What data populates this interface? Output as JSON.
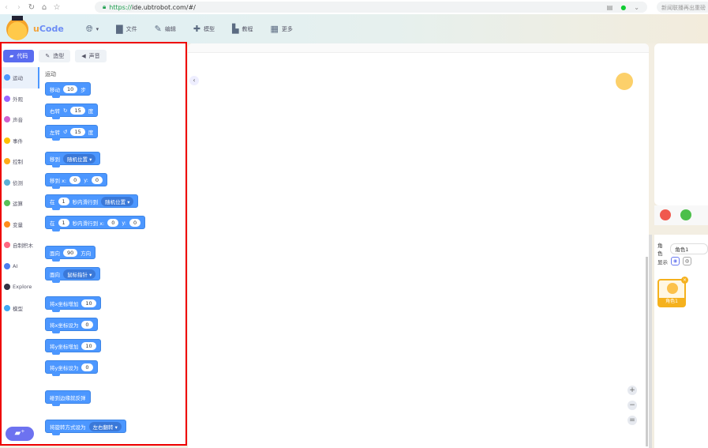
{
  "browser": {
    "url_scheme": "https://",
    "url_rest": "ide.ubtrobot.com/#/",
    "search_text": "新闻联播再出重磅"
  },
  "header": {
    "brand_u": "u",
    "brand_code": "Code",
    "menu": [
      {
        "icon": "folder-icon",
        "glyph": "▇",
        "label": "文件"
      },
      {
        "icon": "pencil-icon",
        "glyph": "✎",
        "label": "编辑"
      },
      {
        "icon": "puzzle-icon",
        "glyph": "✚",
        "label": "模型"
      },
      {
        "icon": "tutorial-icon",
        "glyph": "▙",
        "label": "教程"
      },
      {
        "icon": "grid-icon",
        "glyph": "▦",
        "label": "更多"
      }
    ]
  },
  "tabs": [
    {
      "label": "代码",
      "glyph": "▰"
    },
    {
      "label": "造型",
      "glyph": "✎"
    },
    {
      "label": "声音",
      "glyph": "◀"
    }
  ],
  "categories": [
    {
      "label": "运动",
      "color": "#4c97ff"
    },
    {
      "label": "外观",
      "color": "#9966ff"
    },
    {
      "label": "声音",
      "color": "#cf63cf"
    },
    {
      "label": "事件",
      "color": "#ffbf00"
    },
    {
      "label": "控制",
      "color": "#ffab19"
    },
    {
      "label": "侦测",
      "color": "#5cb1d6"
    },
    {
      "label": "运算",
      "color": "#59c059"
    },
    {
      "label": "变量",
      "color": "#ff8c1a"
    },
    {
      "label": "自制积木",
      "color": "#ff6680"
    },
    {
      "label": "AI",
      "color": "#4c7df0"
    },
    {
      "label": "Explore",
      "color": "#333344"
    },
    {
      "label": "模型",
      "color": "#3fa9f5"
    }
  ],
  "palette": {
    "heading": "运动",
    "blocks": {
      "move": [
        "移动",
        "10",
        "步"
      ],
      "turn_right": [
        "右转",
        "↻",
        "15",
        "度"
      ],
      "turn_left": [
        "左转",
        "↺",
        "15",
        "度"
      ],
      "goto": [
        "移到",
        "随机位置 ▾"
      ],
      "goto_xy": [
        "移到 x:",
        "0",
        "y:",
        "0"
      ],
      "glide": [
        "在",
        "1",
        "秒内滑行到",
        "随机位置 ▾"
      ],
      "glide_xy": [
        "在",
        "1",
        "秒内滑行到 x:",
        "0",
        "y:",
        "0"
      ],
      "point_dir": [
        "面向",
        "90",
        "方向"
      ],
      "point_towards": [
        "面向",
        "鼠标指针 ▾"
      ],
      "change_x": [
        "将x坐标增加",
        "10"
      ],
      "set_x": [
        "将x坐标设为",
        "0"
      ],
      "change_y": [
        "将y坐标增加",
        "10"
      ],
      "set_y": [
        "将y坐标设为",
        "0"
      ],
      "bounce": [
        "碰到边缘就反弹"
      ],
      "rotation": [
        "将旋转方式设为",
        "左右翻转 ▾"
      ]
    }
  },
  "workspace": {
    "zoom_in": "+",
    "zoom_out": "−",
    "reset": "="
  },
  "sprite": {
    "label": "角色",
    "name": "角色1",
    "show_label": "显示",
    "card_name": "角色1"
  }
}
